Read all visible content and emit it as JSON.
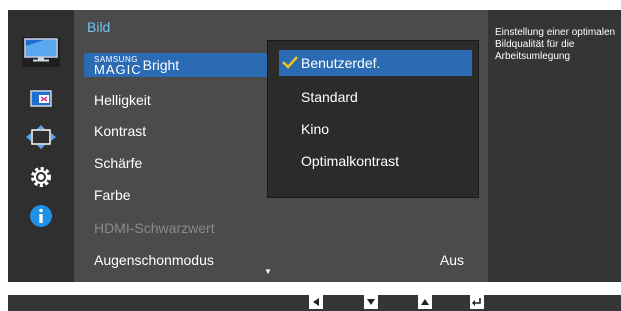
{
  "panel": {
    "title": "Bild"
  },
  "menu": {
    "items": [
      {
        "label_brand_top": "SAMSUNG",
        "label_brand_bottom": "MAGIC",
        "label": "Bright",
        "value": ""
      },
      {
        "label": "Helligkeit",
        "value": ""
      },
      {
        "label": "Kontrast",
        "value": ""
      },
      {
        "label": "Schärfe",
        "value": ""
      },
      {
        "label": "Farbe",
        "value": ""
      },
      {
        "label": "HDMI-Schwarzwert",
        "value": "",
        "disabled": true
      },
      {
        "label": "Augenschonmodus",
        "value": "Aus"
      }
    ],
    "more_indicator": "▼"
  },
  "submenu": {
    "options": [
      "Benutzerdef.",
      "Standard",
      "Kino",
      "Optimalkontrast"
    ],
    "selected_index": 0
  },
  "help": {
    "text": "Einstellung einer optimalen Bildqualität für die Arbeitsumlegung"
  },
  "sidebar": {
    "icons": [
      "picture-icon",
      "color-screen-icon",
      "resize-icon",
      "gear-icon",
      "info-icon"
    ],
    "active_index": 0
  },
  "colors": {
    "accent": "#2b6bb3",
    "title": "#6fc3ef",
    "info": "#1e90e6"
  },
  "keys": [
    "left-arrow-key-icon",
    "down-arrow-key-icon",
    "up-arrow-key-icon",
    "enter-key-icon"
  ]
}
